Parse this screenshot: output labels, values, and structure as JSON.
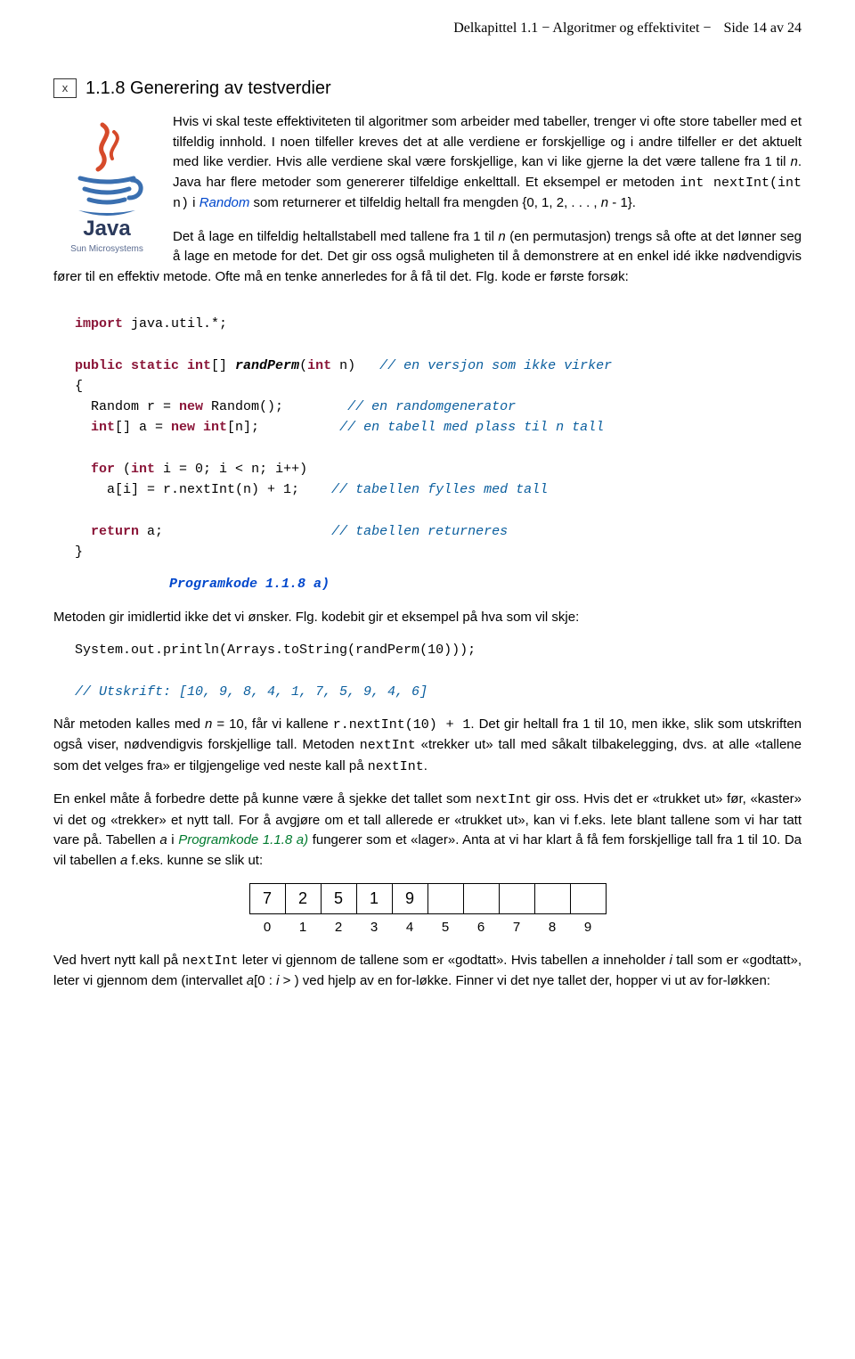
{
  "header": {
    "chapter": "Delkapittel 1.1 − Algoritmer og effektivitet",
    "separator": "−",
    "page": "Side 14 av 24"
  },
  "section": {
    "index_symbol": "x",
    "number_title": "1.1.8  Generering av testverdier"
  },
  "logo": {
    "text": "Java",
    "vendor": "Sun Microsystems"
  },
  "para1_parts": {
    "a": "Hvis vi skal teste effektiviteten til algoritmer som arbeider med tabeller, trenger vi ofte store tabeller med et tilfeldig innhold. I noen tilfeller kreves det at alle verdiene er forskjellige og i andre tilfeller er det aktuelt med like verdier. Hvis alle verdiene skal være forskjellige, kan vi like gjerne la det være tallene fra 1 til ",
    "n": "n",
    "b": ". Java har flere metoder som genererer tilfeldige enkelttall. Et eksempel er metoden ",
    "method": "int nextInt(int n)",
    "c": " i ",
    "random_ref": "Random",
    "d": " som returnerer et tilfeldig heltall fra mengden {0, 1, 2, . . . , ",
    "n2": "n",
    "e": " - 1}."
  },
  "para2": {
    "a": "Det å lage en tilfeldig heltallstabell med tallene fra 1 til ",
    "n": "n",
    "b": " (en permutasjon) trengs så ofte at det lønner seg å lage en metode for det. Det gir oss også muligheten til å demonstrere at en enkel idé ikke nødvendigvis fører til en effektiv metode. Ofte må en tenke annerledes for å få til det. Flg. kode er første forsøk:"
  },
  "code1": {
    "l1a": "import",
    "l1b": " java.util.*;",
    "l3a": "public static int",
    "l3b": "[] ",
    "l3fn": "randPerm",
    "l3c": "(",
    "l3d": "int",
    "l3e": " n)   ",
    "l3cm": "// en versjon som ikke virker",
    "l4": "{",
    "l5a": "  Random r = ",
    "l5b": "new",
    "l5c": " Random();        ",
    "l5cm": "// en randomgenerator",
    "l6a": "  int",
    "l6b": "[] a = ",
    "l6c": "new int",
    "l6d": "[n];          ",
    "l6cm": "// en tabell med plass til n tall",
    "l8a": "  for",
    "l8b": " (",
    "l8c": "int",
    "l8d": " i = 0; i < n; i++)",
    "l9a": "    a[i] = r.nextInt(n) + 1;    ",
    "l9cm": "// tabellen fylles med tall",
    "l11a": "  return",
    "l11b": " a;                     ",
    "l11cm": "// tabellen returneres",
    "l12": "}"
  },
  "caption1": "Programkode 1.1.8 a)",
  "para3": "Metoden gir imidlertid ikke det vi ønsker. Flg. kodebit gir et eksempel på hva som vil skje:",
  "code2": {
    "l1": "System.out.println(Arrays.toString(randPerm(10)));",
    "l3cm": "// Utskrift: [10, 9, 8, 4, 1, 7, 5, 9, 4, 6]"
  },
  "para4": {
    "a": "Når metoden kalles med ",
    "n": "n",
    "b": " = 10, får vi kallene ",
    "call": "r.nextInt(10) + 1",
    "c": ". Det gir heltall fra 1 til 10, men ikke, slik som utskriften også viser, nødvendigvis forskjellige tall. Metoden ",
    "m1": "nextInt",
    "d": " «trekker ut» tall med såkalt tilbakelegging, dvs. at alle «tallene som det velges fra» er tilgjengelige ved neste kall på ",
    "m2": "nextInt",
    "e": "."
  },
  "para5": {
    "a": "En enkel måte å forbedre dette på kunne være å sjekke det tallet som ",
    "m1": "nextInt",
    "b": " gir oss. Hvis det er «trukket ut» før, «kaster» vi det og «trekker» et nytt tall. For å avgjøre om et tall allerede er «trukket ut», kan vi f.eks. lete blant tallene som vi har tatt vare på. Tabellen ",
    "avar": "a",
    "c": " i ",
    "ref": "Programkode 1.1.8 a)",
    "d": " fungerer som et «lager». Anta at vi har klart å få fem forskjellige tall fra 1 til 10. Da vil tabellen ",
    "avar2": "a",
    "e": " f.eks. kunne se slik ut:"
  },
  "array": {
    "cells": [
      "7",
      "2",
      "5",
      "1",
      "9",
      "",
      "",
      "",
      "",
      ""
    ],
    "indices": [
      "0",
      "1",
      "2",
      "3",
      "4",
      "5",
      "6",
      "7",
      "8",
      "9"
    ]
  },
  "para6": {
    "a": "Ved hvert nytt kall på ",
    "m1": "nextInt",
    "b": " leter vi gjennom de tallene som er «godtatt». Hvis tabellen ",
    "avar": "a",
    "c": " inneholder ",
    "ivar": "i",
    "d": " tall som er «godtatt», leter vi gjennom dem (intervallet ",
    "interval_a": "a",
    "e": "[0 : ",
    "interval_i": "i",
    "f": " > ) ved hjelp av en for-løkke. Finner vi det nye tallet der, hopper vi ut av for-løkken:"
  }
}
